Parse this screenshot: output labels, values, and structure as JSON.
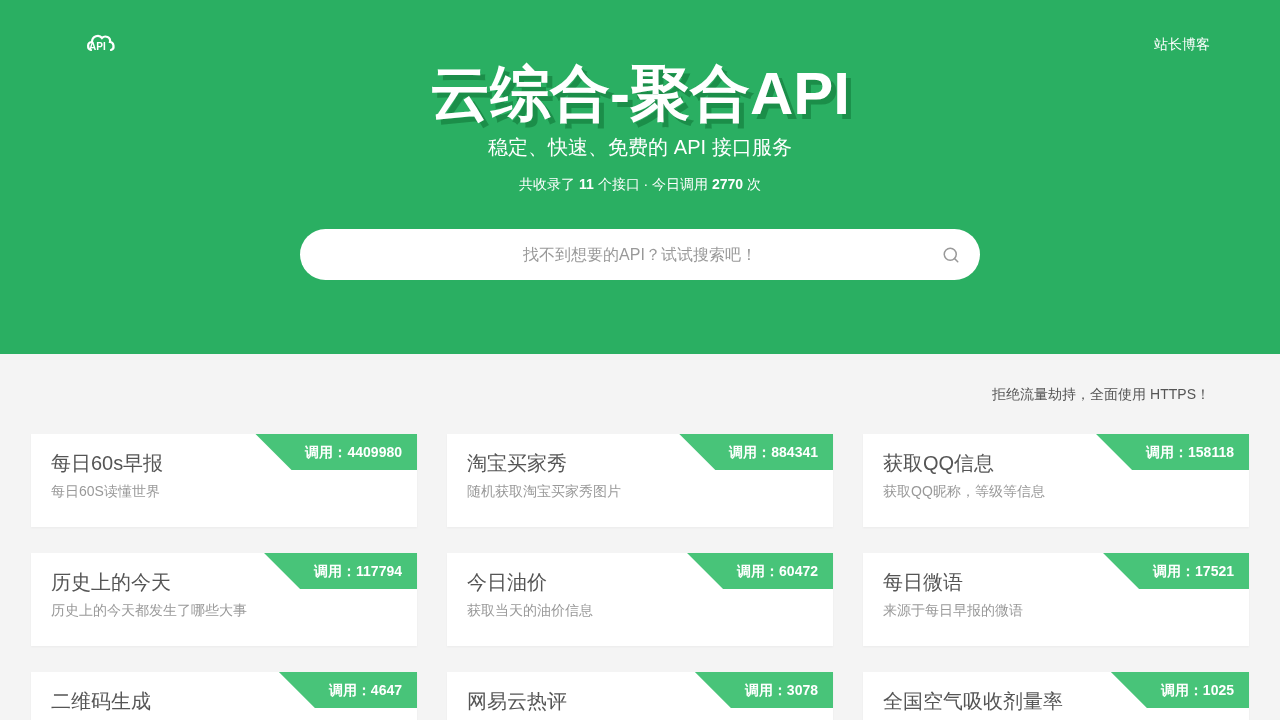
{
  "header": {
    "logo_text": "API",
    "nav_link": "站长博客",
    "title": "云综合-聚合API",
    "subtitle": "稳定、快速、免费的 API 接口服务",
    "stats": "共收录了 **11** 个接口 · 今日调用 **2770** 次",
    "search": {
      "placeholder": "找不到想要的API？试试搜索吧！"
    }
  },
  "notice": "拒绝流量劫持，全面使用 HTTPS！",
  "cards": [
    {
      "title": "每日60s早报",
      "description": "每日60S读懂世界",
      "calls": "调用：4409980"
    },
    {
      "title": "淘宝买家秀",
      "description": "随机获取淘宝买家秀图片",
      "calls": "调用：884341"
    },
    {
      "title": "获取QQ信息",
      "description": "获取QQ昵称，等级等信息",
      "calls": "调用：158118"
    },
    {
      "title": "历史上的今天",
      "description": "历史上的今天都发生了哪些大事",
      "calls": "调用：117794"
    },
    {
      "title": "今日油价",
      "description": "获取当天的油价信息",
      "calls": "调用：60472"
    },
    {
      "title": "每日微语",
      "description": "来源于每日早报的微语",
      "calls": "调用：17521"
    },
    {
      "title": "二维码生成",
      "calls": "调用：4647"
    },
    {
      "title": "网易云热评",
      "calls": "调用：3078"
    },
    {
      "title": "全国空气吸收剂量率",
      "calls": "调用：1025"
    }
  ]
}
